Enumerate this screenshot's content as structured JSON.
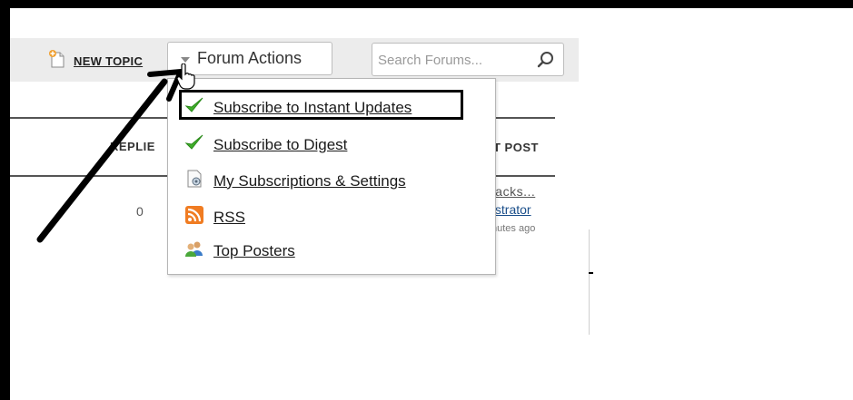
{
  "toolbar": {
    "new_topic_label": "NEW TOPIC",
    "forum_actions_label": "Forum Actions",
    "search": {
      "placeholder": "Search Forums...",
      "value": ""
    }
  },
  "forum_actions_menu": {
    "items": [
      {
        "label": "Subscribe to Instant Updates",
        "icon": "check-icon",
        "highlighted": true
      },
      {
        "label": "Subscribe to Digest",
        "icon": "check-icon"
      },
      {
        "label": "My Subscriptions & Settings",
        "icon": "settings-document-icon"
      },
      {
        "label": "RSS",
        "icon": "rss-icon"
      },
      {
        "label": "Top Posters",
        "icon": "users-icon"
      }
    ]
  },
  "table": {
    "columns": {
      "replies": "REPLIE",
      "last_post": "T POST"
    },
    "rows": [
      {
        "replies": "0",
        "last_post_title": "backs...",
        "last_post_author": "nistrator",
        "last_post_time": "nutes ago"
      }
    ]
  },
  "colors": {
    "check": "#3fae2a",
    "rss": "#f07c22",
    "link_blue": "#1a4e8a",
    "toolbar_bg": "#ececec"
  }
}
